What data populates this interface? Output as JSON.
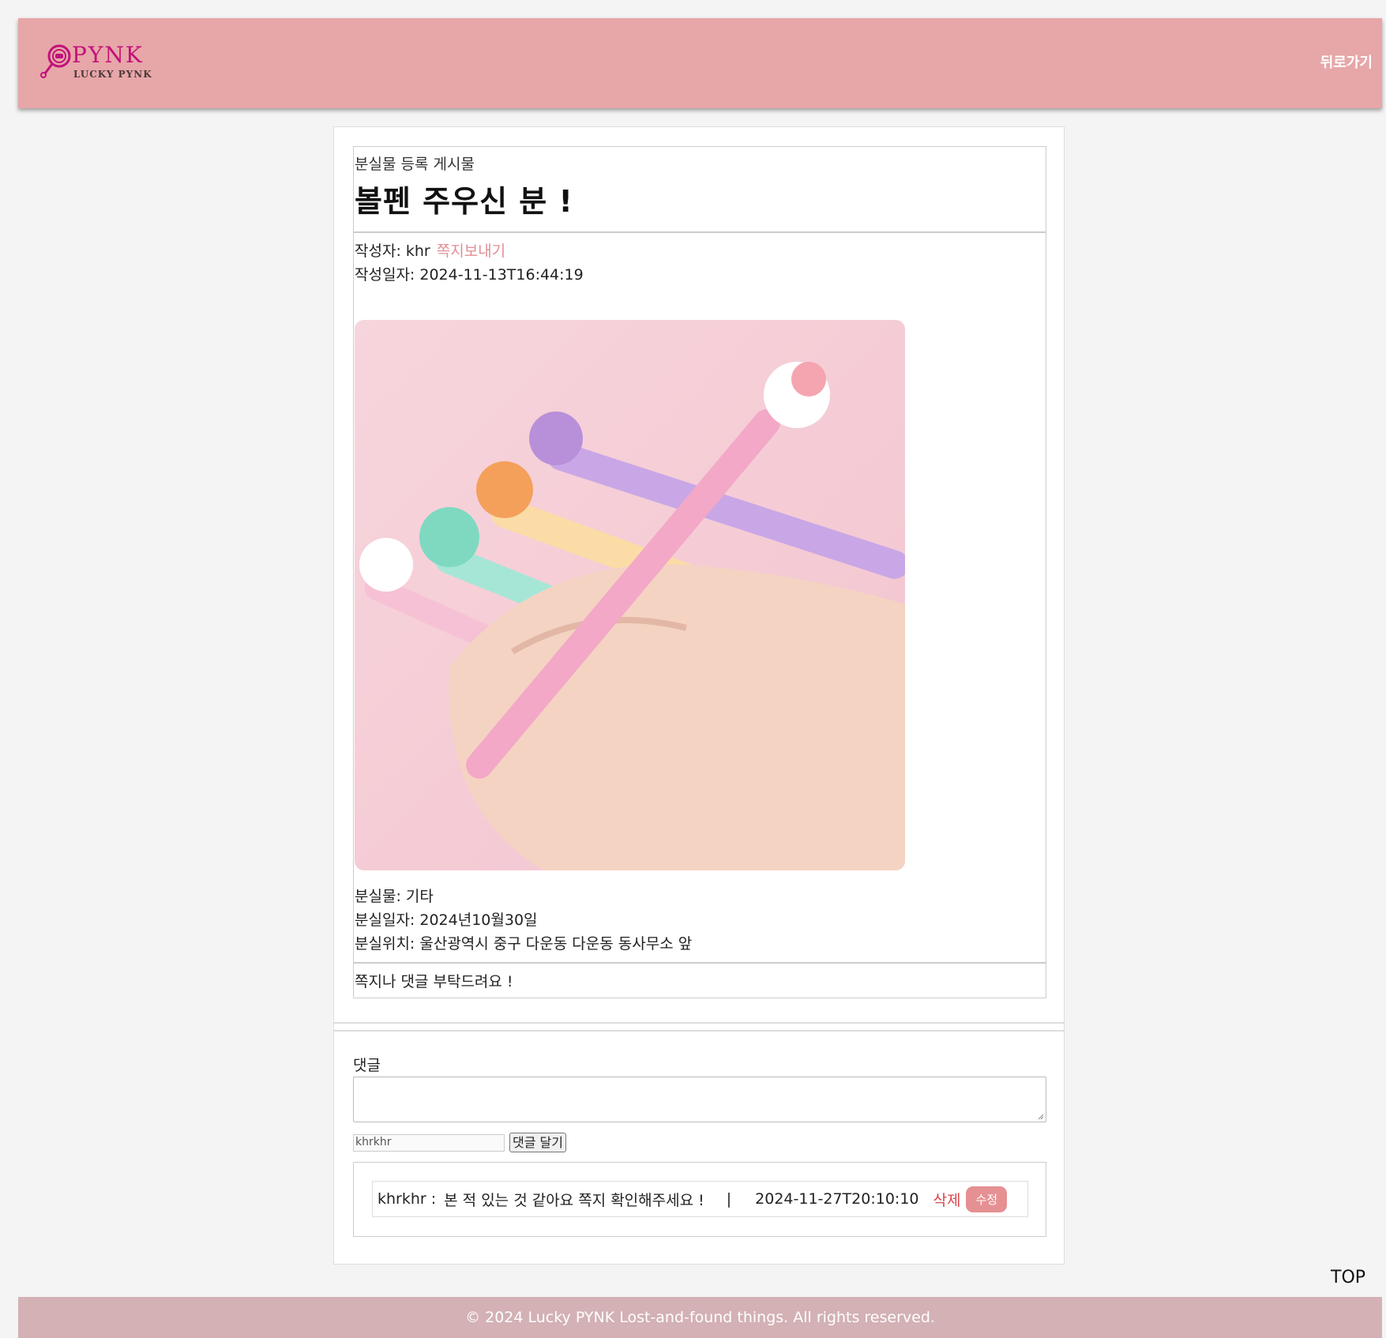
{
  "header": {
    "logo_text": "PYNK",
    "logo_sub": "LUCKY PYNK",
    "back_label": "뒤로가기"
  },
  "post": {
    "category": "분실물 등록 게시물",
    "title": "볼펜 주우신 분 !",
    "author_label": "작성자: khr",
    "send_message_label": "쪽지보내기",
    "date_label": "작성일자: 2024-11-13T16:44:19",
    "photo_icon": "pen-photo",
    "item_label": "분실물: 기타",
    "lost_date_label": "분실일자: 2024년10월30일",
    "lost_location_label": "분실위치: 울산광역시 중구 다운동 다운동 동사무소 앞",
    "content": "쪽지나 댓글 부탁드려요 !"
  },
  "comment_form": {
    "label": "댓글",
    "textarea_value": "",
    "writer_value": "khrkhr",
    "submit_label": "댓글 달기"
  },
  "comments": [
    {
      "author": "khrkhr :",
      "text": "본 적 있는 것 같아요 쪽지 확인해주세요 !",
      "separator": "|",
      "date": "2024-11-27T20:10:10",
      "delete_label": "삭제",
      "edit_label": "수정"
    }
  ],
  "top_label": "TOP",
  "footer": {
    "text": "© 2024 Lucky PYNK Lost-and-found things. All rights reserved."
  },
  "colors": {
    "header_bg": "#e7a6a8",
    "footer_bg": "#d3b1b4",
    "accent": "#e08f94",
    "delete": "#d9464c",
    "logo": "#c2127a"
  }
}
